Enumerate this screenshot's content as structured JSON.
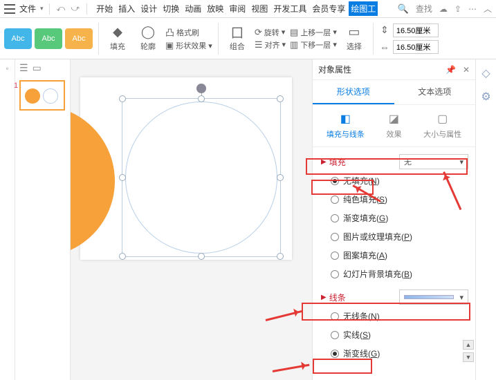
{
  "menubar": {
    "file": "文件",
    "tabs": [
      "开始",
      "插入",
      "设计",
      "切换",
      "动画",
      "放映",
      "审阅",
      "视图",
      "开发工具",
      "会员专享",
      "绘图工"
    ],
    "search": "查找"
  },
  "ribbon": {
    "sample_label": "Abc",
    "fill": "填充",
    "outline": "轮廓",
    "format_brush": "格式刷",
    "shape_effect": "形状效果",
    "group": "组合",
    "rotate": "旋转",
    "align": "对齐",
    "bring_forward": "上移一层",
    "send_backward": "下移一层",
    "select": "选择",
    "height_val": "16.50厘米",
    "width_val": "16.50厘米"
  },
  "thumbs": {
    "index": "1"
  },
  "panel": {
    "title": "对象属性",
    "tab_shape": "形状选项",
    "tab_text": "文本选项",
    "sub_fill_line": "填充与线条",
    "sub_effect": "效果",
    "sub_size": "大小与属性",
    "fill_section": "填充",
    "fill_none_dd": "无",
    "fill_opts": {
      "none": "无填充",
      "solid": "纯色填充",
      "gradient": "渐变填充",
      "picture": "图片或纹理填充",
      "pattern": "图案填充",
      "slide_bg": "幻灯片背景填充"
    },
    "hk": {
      "none": "N",
      "solid": "S",
      "gradient": "G",
      "picture": "P",
      "pattern": "A",
      "slide_bg": "B",
      "noline": "N",
      "solidline": "S",
      "gradline": "G"
    },
    "line_section": "线条",
    "line_opts": {
      "none": "无线条",
      "solid": "实线",
      "gradient": "渐变线"
    }
  }
}
